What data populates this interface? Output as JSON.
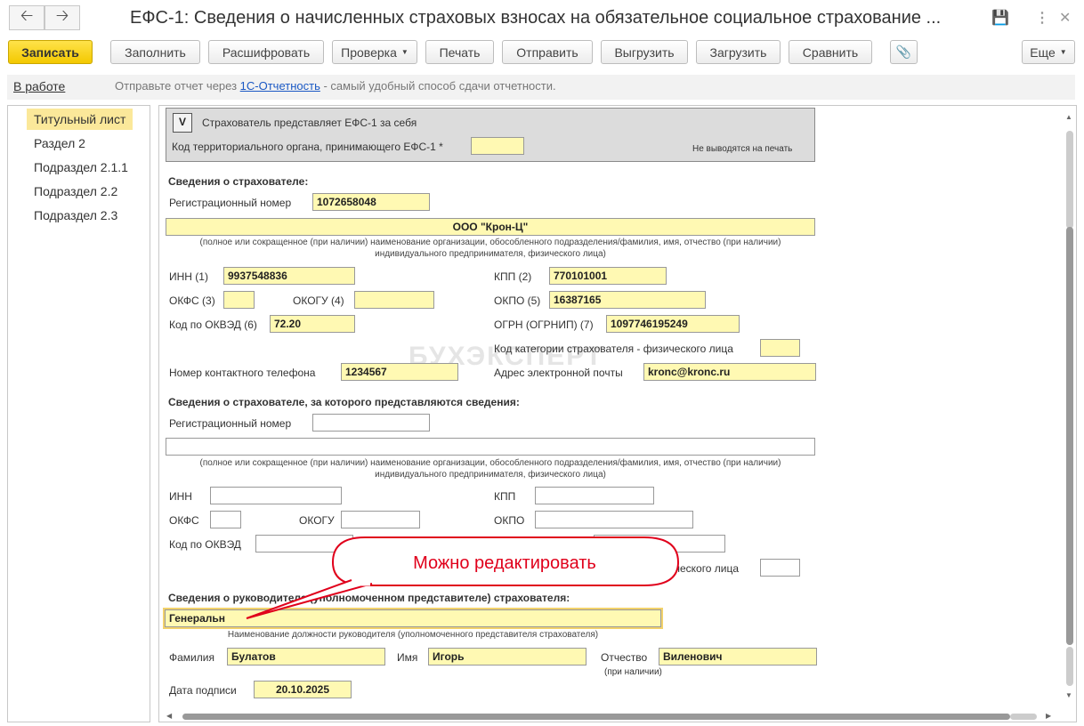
{
  "window": {
    "title": "ЕФС-1: Сведения о начисленных страховых взносах на обязательное социальное страхование ..."
  },
  "toolbar": {
    "save": "Записать",
    "fill": "Заполнить",
    "decode": "Расшифровать",
    "check": "Проверка",
    "print": "Печать",
    "send": "Отправить",
    "export": "Выгрузить",
    "import": "Загрузить",
    "compare": "Сравнить",
    "more": "Еще"
  },
  "status": {
    "state": "В работе",
    "info_prefix": "Отправьте отчет через ",
    "info_link": "1С-Отчетность",
    "info_suffix": " - самый удобный способ сдачи отчетности."
  },
  "sidebar": {
    "items": [
      "Титульный лист",
      "Раздел 2",
      "Подраздел 2.1.1",
      "Подраздел 2.2",
      "Подраздел 2.3"
    ]
  },
  "form": {
    "self_flag": "V",
    "self_label": "Страхователь представляет ЕФС-1 за себя",
    "terr_label": "Код территориального органа, принимающего ЕФС-1 *",
    "noprint": "Не выводятся на печать",
    "s1": {
      "title": "Сведения о страхователе:",
      "reg_label": "Регистрационный номер",
      "reg": "1072658048",
      "org": "ООО \"Крон-Ц\"",
      "note1": "(полное или сокращенное (при наличии) наименование организации, обособленного подразделения/фамилия, имя, отчество (при наличии)",
      "note2": "индивидуального предпринимателя, физического лица)",
      "inn_label": "ИНН (1)",
      "inn": "9937548836",
      "kpp_label": "КПП (2)",
      "kpp": "770101001",
      "okfs_label": "ОКФС (3)",
      "okogu_label": "ОКОГУ (4)",
      "okpo_label": "ОКПО (5)",
      "okpo": "16387165",
      "okved_label": "Код по ОКВЭД (6)",
      "okved": "72.20",
      "ogrn_label": "ОГРН (ОГРНИП) (7)",
      "ogrn": "1097746195249",
      "cat_label": "Код категории страхователя - физического лица",
      "phone_label": "Номер контактного телефона",
      "phone": "1234567",
      "email_label": "Адрес электронной почты",
      "email": "kronc@kronc.ru"
    },
    "s2": {
      "title": "Сведения о страхователе, за которого представляются сведения:",
      "reg_label": "Регистрационный номер",
      "note1": "(полное или сокращенное (при наличии) наименование организации, обособленного подразделения/фамилия, имя, отчество (при наличии)",
      "note2": "индивидуального предпринимателя, физического лица)",
      "inn_label": "ИНН",
      "kpp_label": "КПП",
      "okfs_label": "ОКФС",
      "okogu_label": "ОКОГУ",
      "okpo_label": "ОКПО",
      "okved_label": "Код по ОКВЭД",
      "cat_label": "ического лица"
    },
    "s3": {
      "title": "Сведения о руководителе (уполномоченном представителе) страхователя:",
      "position": "Генеральн",
      "position_note": "Наименование должности руководителя (уполномоченного представителя страхователя)",
      "surname_label": "Фамилия",
      "surname": "Булатов",
      "name_label": "Имя",
      "name": "Игорь",
      "patronymic_label": "Отчество",
      "patronymic_note": "(при наличии)",
      "patronymic": "Виленович",
      "date_label": "Дата подписи",
      "date": "20.10.2025"
    }
  },
  "callout": {
    "text": "Можно редактировать",
    "color": "#e0001b"
  },
  "watermark": "БУХЭКСПЕРТ"
}
